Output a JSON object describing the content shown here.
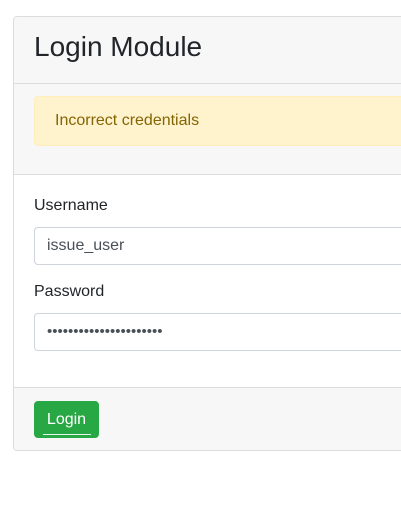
{
  "header": {
    "title": "Login Module"
  },
  "alert": {
    "message": "Incorrect credentials"
  },
  "form": {
    "username_label": "Username",
    "username_value": "issue_user",
    "password_label": "Password",
    "password_value": "••••••••••••••••••••••"
  },
  "footer": {
    "login_label": "Login"
  },
  "colors": {
    "button": "#28a745",
    "alert_bg": "#fff3cd",
    "alert_text": "#856404"
  }
}
